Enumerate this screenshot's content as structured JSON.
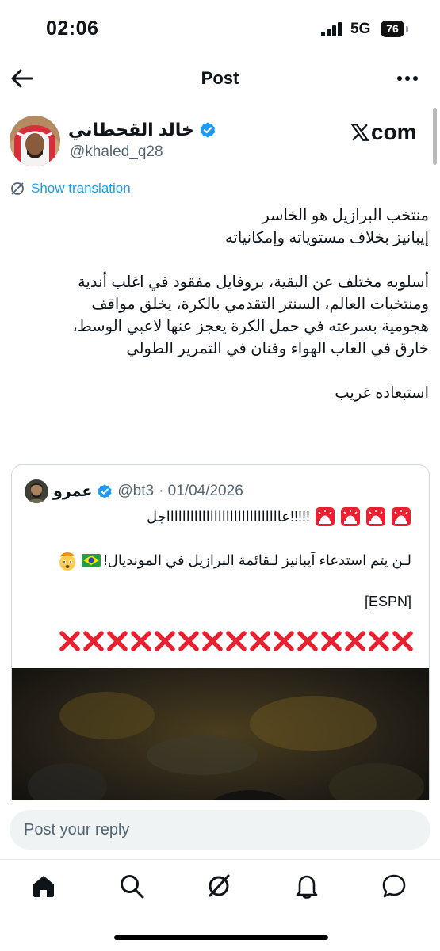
{
  "status_bar": {
    "time": "02:06",
    "network": "5G",
    "battery": "76"
  },
  "header": {
    "title": "Post"
  },
  "author": {
    "name": "خالد القحطاني",
    "handle": "@khaled_q28",
    "source": "com"
  },
  "translation": {
    "label": "Show translation"
  },
  "tweet": {
    "lines": [
      "منتخب البرازيل هو الخاسر",
      "إيبانيز بخلاف مستوياته وإمكانياته",
      "",
      "أسلوبه مختلف عن البقية، بروفايل مفقود في اغلب أندية",
      "ومنتخبات العالم، السنتر التقدمي بالكرة، يخلق مواقف",
      "هجومية بسرعته في حمل الكرة يعجز عنها لاعبي الوسط،",
      "خارق في العاب الهواء وفنان في التمرير الطولي",
      "",
      "استبعاده غريب"
    ]
  },
  "quote": {
    "name": "عمرو",
    "handle": "@bt3",
    "date": "· 01/04/2026",
    "line1": "عاااااااااااااااااااااااااااااجل!!!!!",
    "line2": "لـن يتم استدعاء آيبانيز لـقائمة البرازيل في المونديال!",
    "line3": "[ESPN]",
    "cross_count": 15
  },
  "reply": {
    "placeholder": "Post your reply"
  },
  "nav": [
    "home",
    "search",
    "grok",
    "notifications",
    "messages"
  ],
  "colors": {
    "accent": "#1d9bf0",
    "text": "#0f1419",
    "muted": "#536471",
    "cross": "#e8202f"
  }
}
